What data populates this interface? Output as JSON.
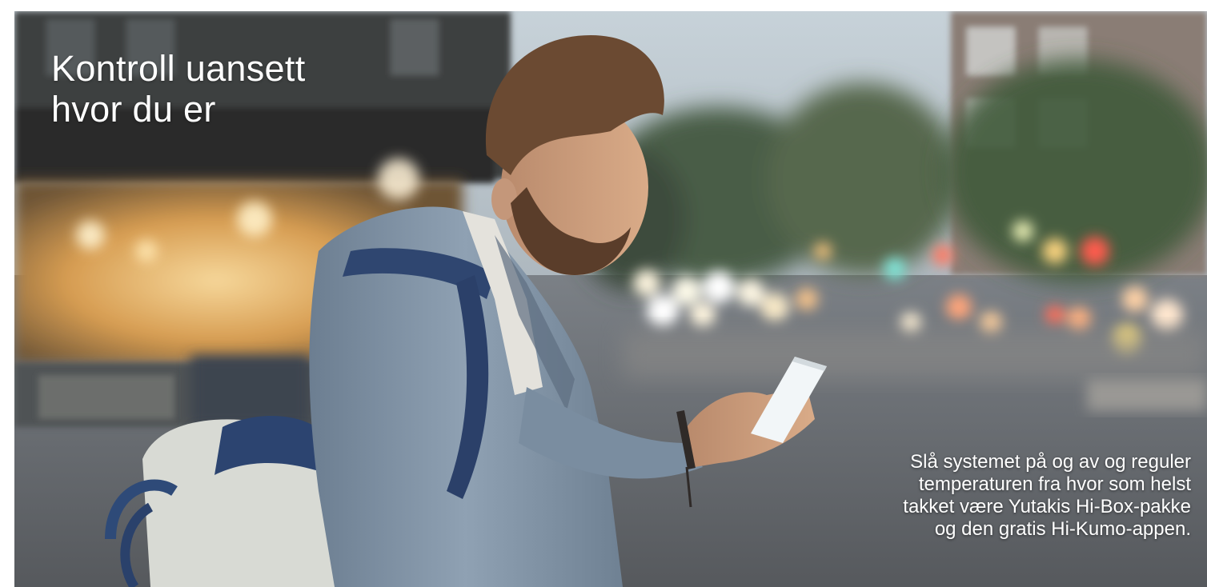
{
  "banner": {
    "headline_lines": [
      "Kontroll uansett",
      "hvor du er"
    ],
    "caption_lines": [
      "Slå systemet på og av og reguler",
      "temperaturen fra hvor som helst",
      "takket være Yutakis Hi-Box-pakke",
      "og den gratis Hi-Kumo-appen."
    ]
  },
  "photo": {
    "subject": "man-with-smartphone-on-city-street",
    "colors": {
      "sky": "#c9d3da",
      "street": "#6e7378",
      "jacket": "#7e90a3",
      "shop_glow": "#e9b86a",
      "hair": "#6b4a32",
      "bag_canvas": "#d9dbd6",
      "bag_strap": "#2e4a78",
      "phone_screen": "#f2f6f8"
    }
  }
}
